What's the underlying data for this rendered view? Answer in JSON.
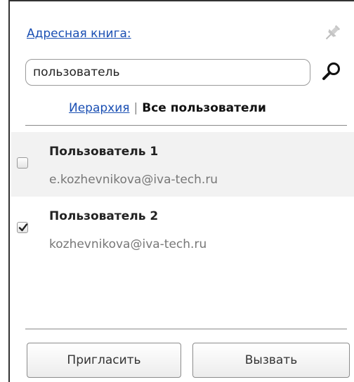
{
  "address_book": {
    "link_label": "Адресная книга:"
  },
  "search": {
    "value": "пользователь"
  },
  "view_switch": {
    "hierarchy_label": "Иерархия",
    "separator": "|",
    "all_users_label": "Все пользователи",
    "active": "all_users"
  },
  "users": [
    {
      "name": "Пользователь 1",
      "email": "e.kozhevnikova@iva-tech.ru",
      "checked": false
    },
    {
      "name": "Пользователь 2",
      "email": "kozhevnikova@iva-tech.ru",
      "checked": true
    }
  ],
  "buttons": {
    "invite_label": "Пригласить",
    "call_label": "Вызвать"
  },
  "icons": {
    "pin": "pin-icon",
    "search": "search-icon",
    "check": "checkmark-icon"
  },
  "colors": {
    "link": "#1a4fb3",
    "selected_row_bg": "#f2f2f2",
    "email_text": "#777777"
  }
}
